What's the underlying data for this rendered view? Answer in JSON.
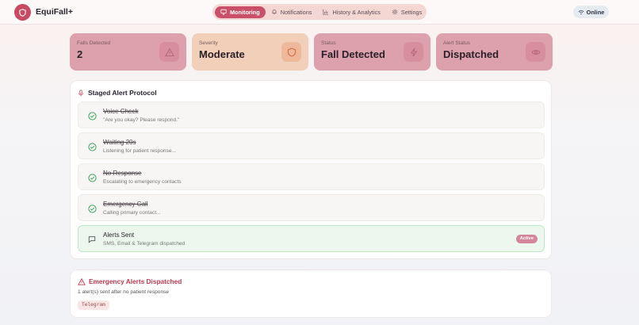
{
  "app": {
    "name": "EquiFall+"
  },
  "nav": {
    "items": [
      {
        "label": "Monitoring",
        "icon": "monitor-icon",
        "active": true
      },
      {
        "label": "Notifications",
        "icon": "bell-icon",
        "active": false
      },
      {
        "label": "History & Analytics",
        "icon": "bar-chart-icon",
        "active": false
      },
      {
        "label": "Settings",
        "icon": "gear-icon",
        "active": false
      }
    ]
  },
  "status": {
    "label": "Online",
    "icon": "wifi-icon"
  },
  "cards": [
    {
      "label": "Falls Detected",
      "value": "2",
      "icon": "warning-icon"
    },
    {
      "label": "Severity",
      "value": "Moderate",
      "icon": "shield-icon"
    },
    {
      "label": "Status",
      "value": "Fall Detected",
      "icon": "lightning-icon"
    },
    {
      "label": "Alert Status",
      "value": "Dispatched",
      "icon": "eye-icon"
    }
  ],
  "protocol": {
    "title": "Staged Alert Protocol",
    "steps": [
      {
        "title": "Voice Check",
        "sub": "\"Are you okay? Please respond.\"",
        "done": true
      },
      {
        "title": "Waiting 20s",
        "sub": "Listening for patient response...",
        "done": true
      },
      {
        "title": "No Response",
        "sub": "Escalating to emergency contacts",
        "done": true
      },
      {
        "title": "Emergency Call",
        "sub": "Calling primary contact...",
        "done": true
      },
      {
        "title": "Alerts Sent",
        "sub": "SMS, Email & Telegram dispatched",
        "done": false,
        "badge": "Active"
      }
    ]
  },
  "dispatch": {
    "title": "Emergency Alerts Dispatched",
    "sub": "1 alert(s) sent after no patient response",
    "channels": [
      "Telegram"
    ]
  },
  "colors": {
    "brand": "#c84a63",
    "card_pink": "#dda0ad",
    "card_orange": "#f1cfb8",
    "success": "#3aa65a",
    "danger": "#c0384f"
  }
}
